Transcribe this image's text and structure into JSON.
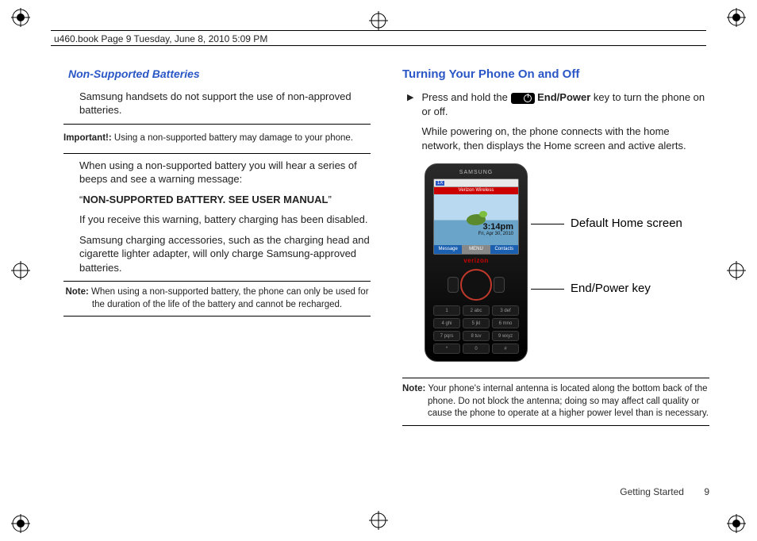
{
  "header": {
    "text": "u460.book  Page 9  Tuesday, June 8, 2010  5:09 PM"
  },
  "left": {
    "heading": "Non-Supported Batteries",
    "p1": "Samsung handsets do not support the use of non-approved batteries.",
    "important_lead": "Important!:",
    "important_body": " Using a non-supported battery may damage to your phone.",
    "p2": "When using a non-supported battery you will hear a series of beeps and see a warning message:",
    "p3_quote_open": "“",
    "p3_bold": "NON-SUPPORTED BATTERY. SEE USER MANUAL",
    "p3_quote_close": "”",
    "p4": "If you receive this warning, battery charging has been disabled.",
    "p5": "Samsung charging accessories, such as the charging head and cigarette lighter adapter, will only charge Samsung-approved batteries.",
    "note_lead": "Note:",
    "note_body": " When using a non-supported battery, the phone can only be used for the duration of the life of the battery and cannot be recharged."
  },
  "right": {
    "heading": "Turning Your Phone On and Off",
    "step_pre": "Press and hold the ",
    "step_key": " End/Power",
    "step_post": " key to turn the phone on or off.",
    "p2": "While powering on, the phone connects with the home network, then displays the Home screen and active alerts.",
    "callout1": "Default Home screen",
    "callout2": "End/Power key",
    "note_lead": "Note:",
    "note_body": " Your phone's internal antenna is located along the bottom back of the phone. Do not block the antenna; doing so may affect call quality or cause the phone to operate at a higher power level than is necessary."
  },
  "phone": {
    "brand": "SAMSUNG",
    "status": "1X",
    "carrier": "Verizon Wireless",
    "time": "3:14pm",
    "date": "Fri, Apr 30, 2010",
    "soft_left": "Message",
    "soft_mid": "MENU",
    "soft_right": "Contacts",
    "logo": "verizon",
    "keys": [
      "1",
      "2 abc",
      "3 def",
      "4 ghi",
      "5 jkl",
      "6 mno",
      "7 pqrs",
      "8 tuv",
      "9 wxyz",
      "*",
      "0",
      "#"
    ]
  },
  "footer": {
    "section": "Getting Started",
    "page": "9"
  }
}
